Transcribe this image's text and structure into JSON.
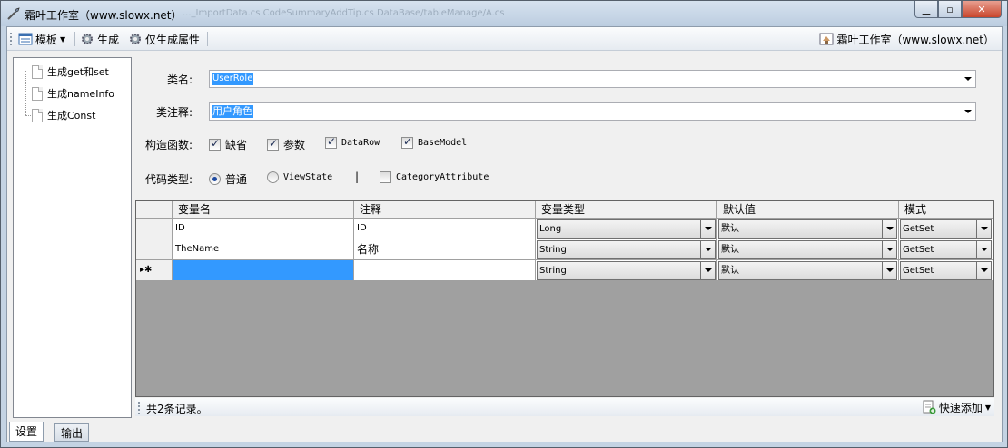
{
  "window": {
    "title": "霜叶工作室（www.slowx.net）",
    "ghost_text": "..._ImportData.cs   CodeSummaryAddTip.cs   DataBase/tableManage/A.cs"
  },
  "toolbar": {
    "template_label": "模板",
    "generate_label": "生成",
    "generate_props_label": "仅生成属性",
    "studio_label": "霜叶工作室（www.slowx.net）"
  },
  "tree": {
    "items": [
      {
        "label": "生成get和set"
      },
      {
        "label": "生成nameInfo"
      },
      {
        "label": "生成Const"
      }
    ]
  },
  "form": {
    "class_name_label": "类名:",
    "class_name_value": "UserRole",
    "class_comment_label": "类注释:",
    "class_comment_value": "用户角色",
    "ctor_label": "构造函数:",
    "ctor_options": [
      {
        "label": "缺省",
        "checked": true
      },
      {
        "label": "参数",
        "checked": true
      },
      {
        "label": "DataRow",
        "checked": true
      },
      {
        "label": "BaseModel",
        "checked": true
      }
    ],
    "code_type_label": "代码类型:",
    "code_type_options": [
      {
        "label": "普通",
        "selected": true
      },
      {
        "label": "ViewState",
        "selected": false
      }
    ],
    "separator": "|",
    "category_attr_label": "CategoryAttribute",
    "category_attr_checked": false
  },
  "grid": {
    "columns": [
      "变量名",
      "注释",
      "变量类型",
      "默认值",
      "模式"
    ],
    "rows": [
      {
        "name": "ID",
        "comment": "ID",
        "type": "Long",
        "default": "默认",
        "mode": "GetSet"
      },
      {
        "name": "TheName",
        "comment": "名称",
        "type": "String",
        "default": "默认",
        "mode": "GetSet"
      }
    ],
    "new_row": {
      "marker": "▸✱",
      "name": "",
      "comment": "",
      "type": "String",
      "default": "默认",
      "mode": "GetSet"
    }
  },
  "status": {
    "record_count": "共2条记录。",
    "quick_add_label": "快速添加"
  },
  "tabs": [
    {
      "label": "设置",
      "active": true
    },
    {
      "label": "输出",
      "active": false
    }
  ],
  "colors": {
    "selection": "#3399ff",
    "grid_background": "#a0a0a0",
    "window_frame": "#c4d3e3"
  }
}
